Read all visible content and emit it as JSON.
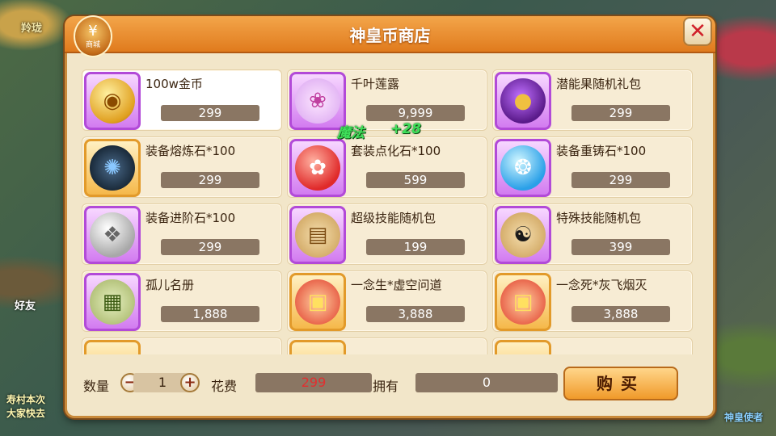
{
  "background": {
    "left_texts": [
      "羚珑",
      "寿村本次",
      "大家快去"
    ],
    "friend_label": "好友",
    "right_texts": [
      "神皇使者"
    ]
  },
  "shop": {
    "title": "神皇币商店",
    "emblem_label": "商城",
    "close_icon": "close-x-icon"
  },
  "items": [
    {
      "name": "100w金币",
      "price": "299",
      "icon": "gold-coin-icon",
      "frame": "purple",
      "selected": true
    },
    {
      "name": "千叶莲露",
      "price": "9,999",
      "icon": "lotus-vase-icon",
      "frame": "purple",
      "selected": false
    },
    {
      "name": "潜能果随机礼包",
      "price": "299",
      "icon": "purple-bag-icon",
      "frame": "purple",
      "selected": false
    },
    {
      "name": "装备熔炼石*100",
      "price": "299",
      "icon": "dark-stone-icon",
      "frame": "orange",
      "selected": false
    },
    {
      "name": "套装点化石*100",
      "price": "599",
      "icon": "red-stone-icon",
      "frame": "purple",
      "selected": false
    },
    {
      "name": "装备重铸石*100",
      "price": "299",
      "icon": "blue-stone-icon",
      "frame": "purple",
      "selected": false
    },
    {
      "name": "装备进阶石*100",
      "price": "299",
      "icon": "silver-stone-icon",
      "frame": "purple",
      "selected": false
    },
    {
      "name": "超级技能随机包",
      "price": "199",
      "icon": "scroll-icon",
      "frame": "purple",
      "selected": false
    },
    {
      "name": "特殊技能随机包",
      "price": "399",
      "icon": "taiji-scroll-icon",
      "frame": "purple",
      "selected": false
    },
    {
      "name": "孤儿名册",
      "price": "1,888",
      "icon": "green-scroll-icon",
      "frame": "purple",
      "selected": false
    },
    {
      "name": "一念生*虚空问道",
      "price": "3,888",
      "icon": "red-ticket-icon",
      "frame": "orange",
      "selected": false
    },
    {
      "name": "一念死*灰飞烟灭",
      "price": "3,888",
      "icon": "red-ticket-icon",
      "frame": "orange",
      "selected": false
    }
  ],
  "float": {
    "label": "魔法",
    "value": "+28"
  },
  "bottom": {
    "qty_label": "数量",
    "qty_value": "1",
    "cost_label": "花费",
    "cost_value": "299",
    "own_label": "拥有",
    "own_value": "0",
    "buy_label": "购买"
  },
  "colors": {
    "accent_orange": "#e07b1d",
    "price_bar": "#8a7663",
    "cost_text": "#e03030",
    "purple_frame": "#b24ad8",
    "orange_frame": "#e29a2a"
  }
}
